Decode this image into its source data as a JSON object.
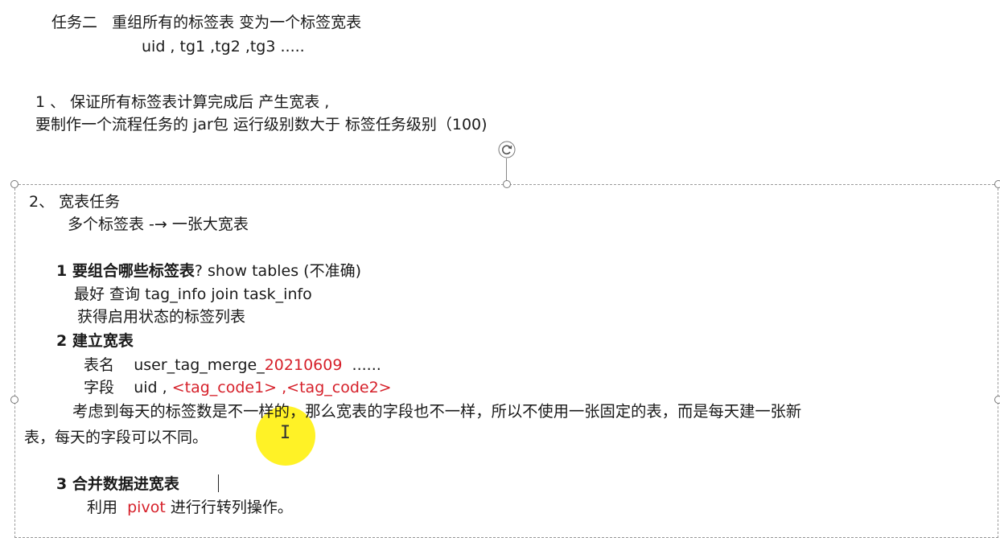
{
  "header": {
    "title_prefix": "任务二",
    "title_rest": "重组所有的标签表 变为一个标签宽表",
    "subtitle": "uid , tg1 ,tg2 ,tg3 ....."
  },
  "step1": {
    "line1": "1 、 保证所有标签表计算完成后  产生宽表     ,",
    "line2": "要制作一个流程任务的 jar包  运行级别数大于 标签任务级别（100)"
  },
  "step2": {
    "heading": "2、 宽表任务",
    "sub": "多个标签表 -→ 一张大宽表",
    "q1_bold": "1  要组合哪些标签表",
    "q1_rest": "?   show tables (不准确)",
    "q1_line2": "最好 查询 tag_info  join  task_info",
    "q1_line3": "获得启用状态的标签列表",
    "q2_bold": "2  建立宽表",
    "table_name_label": "表名",
    "table_name_prefix": "user_tag_merge_",
    "table_name_date": "20210609",
    "table_name_suffix": "......",
    "fields_label": "字段",
    "fields_prefix": "uid ,",
    "fields_red": "<tag_code1> ,<tag_code2>",
    "note_line1": "考虑到每天的标签数是不一样的，那么宽表的字段也不一样，所以不使用一张固定的表，而是每天建一张新",
    "note_line2": "表，每天的字段可以不同。",
    "q3_bold": "3  合并数据进宽表",
    "q3_line_prefix": "利用",
    "q3_line_red": "pivot",
    "q3_line_suffix": "进行行转列操作。"
  },
  "colors": {
    "accent_red": "#d6202a",
    "highlight": "#fff000"
  },
  "icons": [
    "rotate-icon",
    "text-cursor-icon"
  ]
}
